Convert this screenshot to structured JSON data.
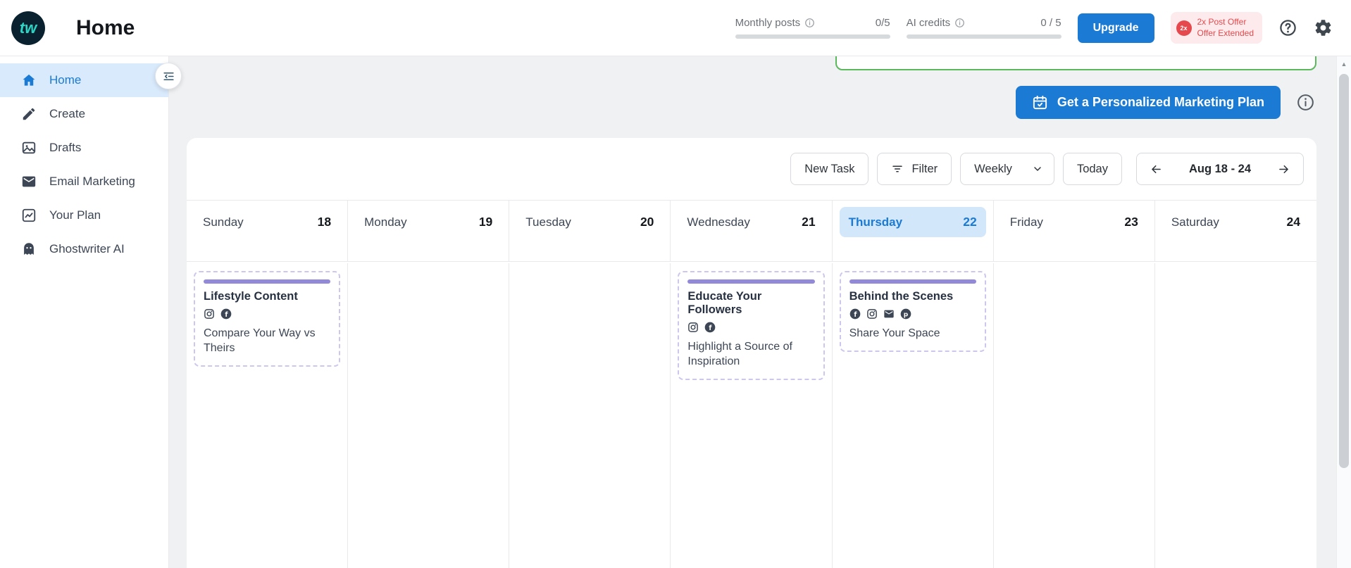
{
  "header": {
    "logo": "tw",
    "title": "Home",
    "monthly_posts": {
      "label": "Monthly posts",
      "count": "0/5"
    },
    "ai_credits": {
      "label": "AI credits",
      "count": "0 / 5"
    },
    "upgrade_label": "Upgrade",
    "offer": {
      "badge": "2x",
      "line1": "2x Post Offer",
      "line2": "Offer Extended"
    }
  },
  "sidebar": {
    "items": [
      {
        "label": "Home",
        "icon": "home-icon",
        "active": true
      },
      {
        "label": "Create",
        "icon": "pencil-icon",
        "active": false
      },
      {
        "label": "Drafts",
        "icon": "image-icon",
        "active": false
      },
      {
        "label": "Email Marketing",
        "icon": "envelope-icon",
        "active": false
      },
      {
        "label": "Your Plan",
        "icon": "chart-icon",
        "active": false
      },
      {
        "label": "Ghostwriter AI",
        "icon": "ghost-icon",
        "active": false
      }
    ]
  },
  "main": {
    "plan_button": "Get a Personalized Marketing Plan",
    "toolbar": {
      "new_task": "New Task",
      "filter": "Filter",
      "view": "Weekly",
      "today": "Today",
      "range": "Aug 18 - 24"
    },
    "days": [
      {
        "name": "Sunday",
        "date": "18"
      },
      {
        "name": "Monday",
        "date": "19"
      },
      {
        "name": "Tuesday",
        "date": "20"
      },
      {
        "name": "Wednesday",
        "date": "21"
      },
      {
        "name": "Thursday",
        "date": "22",
        "active": true
      },
      {
        "name": "Friday",
        "date": "23"
      },
      {
        "name": "Saturday",
        "date": "24"
      }
    ],
    "tasks": [
      {
        "day": "Sunday",
        "title": "Lifestyle Content",
        "platforms": [
          "instagram",
          "facebook"
        ],
        "description": "Compare Your Way vs Theirs"
      },
      {
        "day": "Wednesday",
        "title": "Educate Your Followers",
        "platforms": [
          "instagram",
          "facebook"
        ],
        "description": "Highlight a Source of Inspiration"
      },
      {
        "day": "Thursday",
        "title": "Behind the Scenes",
        "platforms": [
          "facebook",
          "instagram",
          "email",
          "pinterest"
        ],
        "description": "Share Your Space"
      }
    ]
  },
  "colors": {
    "accent_blue": "#1b7ad3",
    "active_item_bg": "#d9eafc",
    "today_pill_bg": "#d2e7fa",
    "task_accent_purple": "#9289d9",
    "task_border_purple": "#cdc7ee",
    "offer_red": "#e5494d",
    "offer_bg_pink": "#fdeaec",
    "green_border": "#5cb85c",
    "logo_teal": "#2cd6c5",
    "logo_bg": "#0a2230"
  }
}
